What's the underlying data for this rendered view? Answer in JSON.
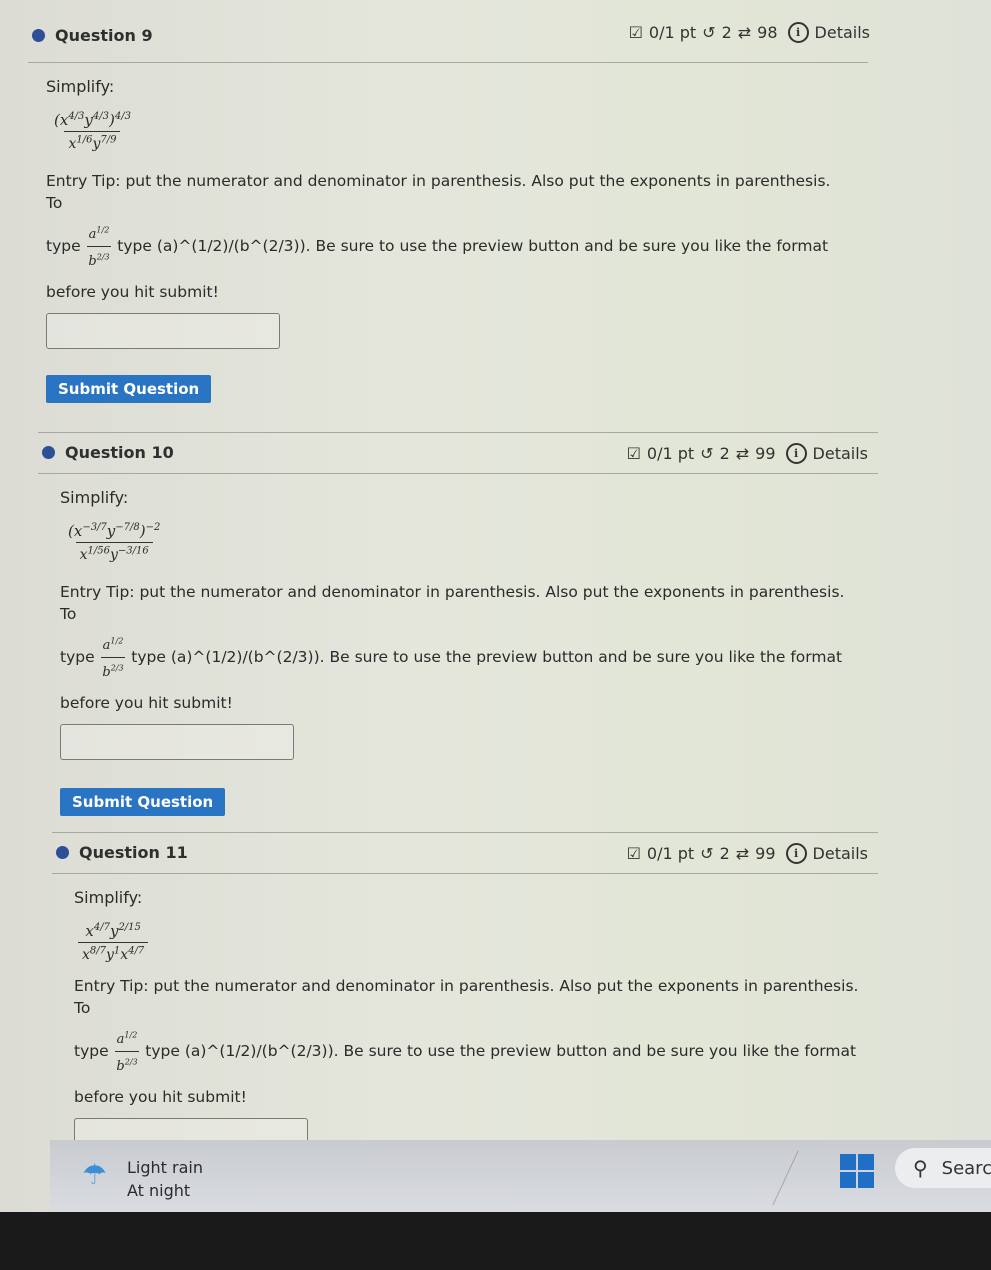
{
  "questions": [
    {
      "title": "Question 9",
      "score": "0/1 pt",
      "attempts": "2",
      "tries": "98",
      "details_label": "Details",
      "prompt": "Simplify:",
      "expression": {
        "numerator": "(x^{4/3} y^{4/3})^{4/3}",
        "num_base": "(x",
        "num_parts": [
          {
            "base": "(x",
            "exp": "4/3"
          },
          {
            "base": "y",
            "exp": "4/3"
          },
          {
            "base": ")",
            "exp": "4/3"
          }
        ],
        "den_parts": [
          {
            "base": "x",
            "exp": "1/6"
          },
          {
            "base": "y",
            "exp": "7/9"
          }
        ]
      },
      "tip_line1": "Entry Tip: put the numerator and denominator in parenthesis. Also put the exponents in parenthesis. To",
      "tip_type": "type",
      "tip_example": "type (a)^(1/2)/(b^(2/3)). Be sure to use the preview button and be sure you like the format",
      "tip_line3": "before you hit submit!",
      "answer_value": "",
      "submit_label": "Submit Question"
    },
    {
      "title": "Question 10",
      "score": "0/1 pt",
      "attempts": "2",
      "tries": "99",
      "details_label": "Details",
      "prompt": "Simplify:",
      "expression": {
        "numerator": "(x^{-3/7} y^{-7/8})^{-2}",
        "num_parts": [
          {
            "base": "(x",
            "exp": "−3/7"
          },
          {
            "base": "y",
            "exp": "−7/8"
          },
          {
            "base": ")",
            "exp": "−2"
          }
        ],
        "den_parts": [
          {
            "base": "x",
            "exp": "1/56"
          },
          {
            "base": "y",
            "exp": "−3/16"
          }
        ]
      },
      "tip_line1": "Entry Tip: put the numerator and denominator in parenthesis. Also put the exponents in parenthesis. To",
      "tip_type": "type",
      "tip_example": "type (a)^(1/2)/(b^(2/3)). Be sure to use the preview button and be sure you like the format",
      "tip_line3": "before you hit submit!",
      "answer_value": "",
      "submit_label": "Submit Question"
    },
    {
      "title": "Question 11",
      "score": "0/1 pt",
      "attempts": "2",
      "tries": "99",
      "details_label": "Details",
      "prompt": "Simplify:",
      "expression": {
        "numerator": "x^{4/7} y^{2/15}",
        "num_parts": [
          {
            "base": "x",
            "exp": "4/7"
          },
          {
            "base": "y",
            "exp": "2/15"
          }
        ],
        "den_parts": [
          {
            "base": "x",
            "exp": "8/7"
          },
          {
            "base": "y",
            "exp": "1"
          },
          {
            "base": "x",
            "exp": "4/7"
          }
        ]
      },
      "tip_line1": "Entry Tip: put the numerator and denominator in parenthesis. Also put the exponents in parenthesis. To",
      "tip_type": "type",
      "tip_example": "type (a)^(1/2)/(b^(2/3)). Be sure to use the preview button and be sure you like the format",
      "tip_line3": "before you hit submit!",
      "answer_value": ""
    }
  ],
  "tip_fraction": {
    "num_base": "a",
    "num_exp": "1/2",
    "den_base": "b",
    "den_exp": "2/3"
  },
  "taskbar": {
    "weather_icon": "umbrella-rain-icon",
    "weather_line1": "Light rain",
    "weather_line2": "At night",
    "start_icon": "windows-logo-icon",
    "search_icon": "magnifier-icon",
    "search_label": "Searc"
  },
  "icons": {
    "score": "checkbox-icon",
    "attempts": "retry-icon",
    "tries": "repeat-icon",
    "details": "info-icon"
  }
}
